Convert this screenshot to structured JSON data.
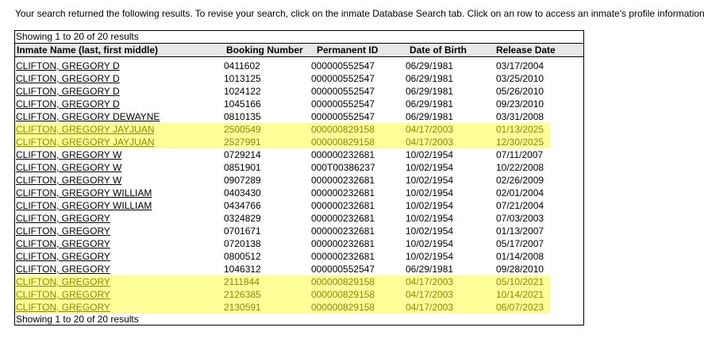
{
  "intro_text": "Your search returned the following results. To revise your search, click on the inmate Database Search tab. Click on an row to access an inmate's profile information",
  "caption_top": "Showing 1 to 20 of 20 results",
  "caption_bottom": "Showing 1 to 20 of 20 results",
  "columns": {
    "name": "Inmate Name (last, first middle)",
    "booking": "Booking Number",
    "permanent": "Permanent ID",
    "dob": "Date of Birth",
    "release": "Release Date"
  },
  "highlight_color": "#ffff99",
  "rows": [
    {
      "name": "CLIFTON, GREGORY D",
      "booking": "0411602",
      "permanent": "000000552547",
      "dob": "06/29/1981",
      "release": "03/17/2004",
      "highlighted": false
    },
    {
      "name": "CLIFTON, GREGORY D",
      "booking": "1013125",
      "permanent": "000000552547",
      "dob": "06/29/1981",
      "release": "03/25/2010",
      "highlighted": false
    },
    {
      "name": "CLIFTON, GREGORY D",
      "booking": "1024122",
      "permanent": "000000552547",
      "dob": "06/29/1981",
      "release": "05/26/2010",
      "highlighted": false
    },
    {
      "name": "CLIFTON, GREGORY D",
      "booking": "1045166",
      "permanent": "000000552547",
      "dob": "06/29/1981",
      "release": "09/23/2010",
      "highlighted": false
    },
    {
      "name": "CLIFTON, GREGORY DEWAYNE",
      "booking": "0810135",
      "permanent": "000000552547",
      "dob": "06/29/1981",
      "release": "03/31/2008",
      "highlighted": false
    },
    {
      "name": "CLIFTON, GREGORY JAYJUAN",
      "booking": "2500549",
      "permanent": "000000829158",
      "dob": "04/17/2003",
      "release": "01/13/2025",
      "highlighted": true
    },
    {
      "name": "CLIFTON, GREGORY JAYJUAN",
      "booking": "2527991",
      "permanent": "000000829158",
      "dob": "04/17/2003",
      "release": "12/30/2025",
      "highlighted": true
    },
    {
      "name": "CLIFTON, GREGORY W",
      "booking": "0729214",
      "permanent": "000000232681",
      "dob": "10/02/1954",
      "release": "07/11/2007",
      "highlighted": false
    },
    {
      "name": "CLIFTON, GREGORY W",
      "booking": "0851901",
      "permanent": "000T00386237",
      "dob": "10/02/1954",
      "release": "10/22/2008",
      "highlighted": false
    },
    {
      "name": "CLIFTON, GREGORY W",
      "booking": "0907289",
      "permanent": "000000232681",
      "dob": "10/02/1954",
      "release": "02/26/2009",
      "highlighted": false
    },
    {
      "name": "CLIFTON, GREGORY WILLIAM",
      "booking": "0403430",
      "permanent": "000000232681",
      "dob": "10/02/1954",
      "release": "02/01/2004",
      "highlighted": false
    },
    {
      "name": "CLIFTON, GREGORY WILLIAM",
      "booking": "0434766",
      "permanent": "000000232681",
      "dob": "10/02/1954",
      "release": "07/21/2004",
      "highlighted": false
    },
    {
      "name": "CLIFTON, GREGORY",
      "booking": "0324829",
      "permanent": "000000232681",
      "dob": "10/02/1954",
      "release": "07/03/2003",
      "highlighted": false
    },
    {
      "name": "CLIFTON, GREGORY",
      "booking": "0701671",
      "permanent": "000000232681",
      "dob": "10/02/1954",
      "release": "01/13/2007",
      "highlighted": false
    },
    {
      "name": "CLIFTON, GREGORY",
      "booking": "0720138",
      "permanent": "000000232681",
      "dob": "10/02/1954",
      "release": "05/17/2007",
      "highlighted": false
    },
    {
      "name": "CLIFTON, GREGORY",
      "booking": "0800512",
      "permanent": "000000232681",
      "dob": "10/02/1954",
      "release": "01/14/2008",
      "highlighted": false
    },
    {
      "name": "CLIFTON, GREGORY",
      "booking": "1046312",
      "permanent": "000000552547",
      "dob": "06/29/1981",
      "release": "09/28/2010",
      "highlighted": false
    },
    {
      "name": "CLIFTON, GREGORY",
      "booking": "2111844",
      "permanent": "000000829158",
      "dob": "04/17/2003",
      "release": "05/10/2021",
      "highlighted": true
    },
    {
      "name": "CLIFTON, GREGORY",
      "booking": "2126385",
      "permanent": "000000829158",
      "dob": "04/17/2003",
      "release": "10/14/2021",
      "highlighted": true
    },
    {
      "name": "CLIFTON, GREGORY",
      "booking": "2130591",
      "permanent": "000000829158",
      "dob": "04/17/2003",
      "release": "06/07/2023",
      "highlighted": true
    }
  ]
}
